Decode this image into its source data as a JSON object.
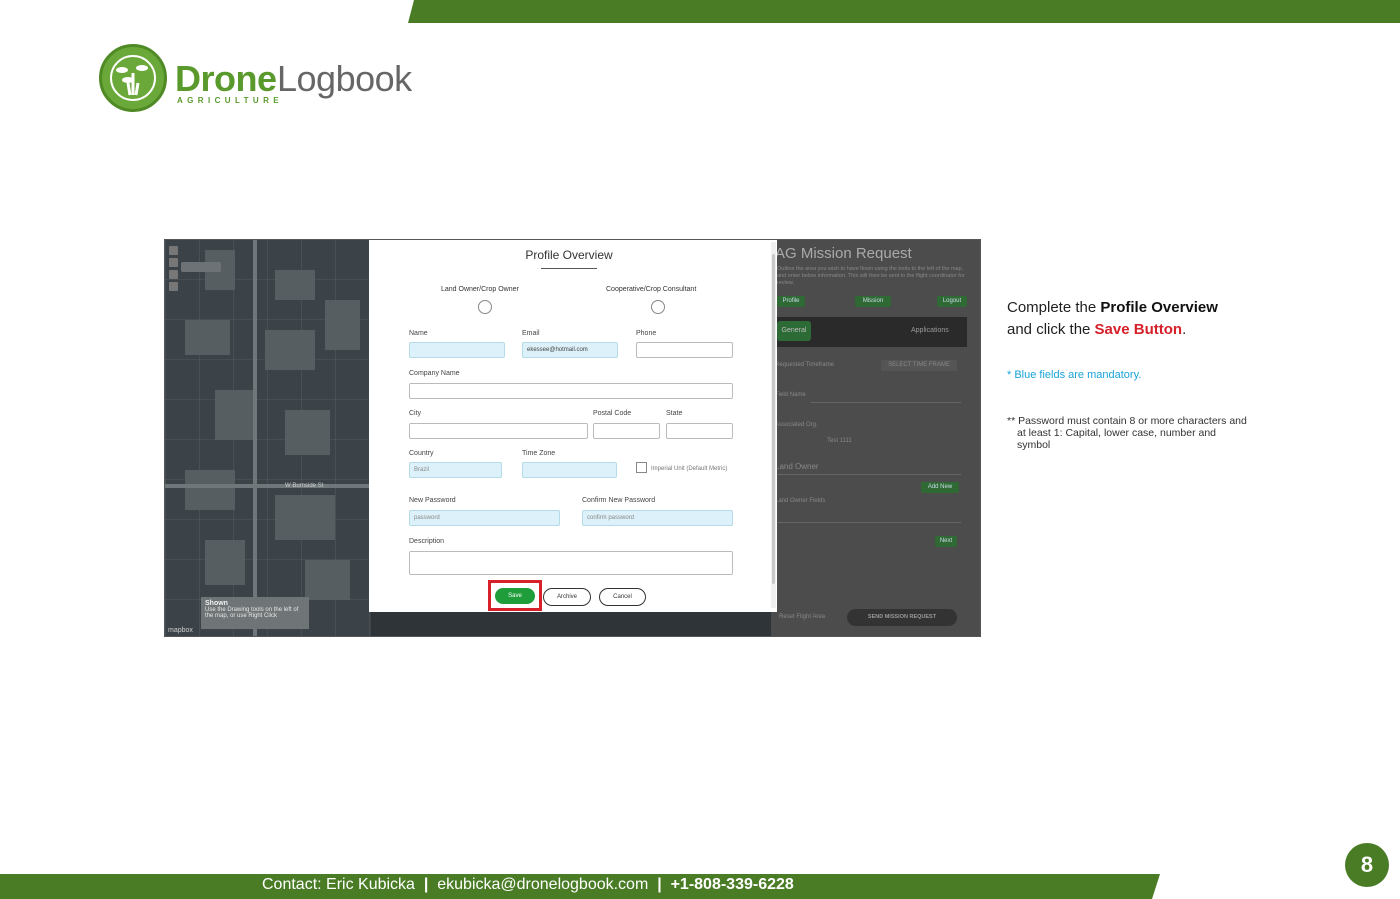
{
  "brand": {
    "name_part1": "Drone",
    "name_part2": "Logbook",
    "tagline": "AGRICULTURE"
  },
  "map": {
    "street_label": "W Burnside St",
    "tip_title": "Shown",
    "tip_text": "Use the Drawing tools on the left of the map, or use Right Click",
    "logo": "mapbox"
  },
  "background_panel": {
    "title": "AG Mission Request",
    "description": "Outline the area you wish to have flown using the tools to the left of the map, and enter below information. This will then be sent to the flight coordinator for review.",
    "buttons": [
      "Profile",
      "Mission",
      "Logout"
    ],
    "tabs": [
      "General",
      "Applications"
    ],
    "fields": [
      "Requested Timeframe",
      "Field Name",
      "Associated Org.",
      "Land Owner",
      "Land Owner Fields"
    ],
    "timeframe_button": "SELECT TIME FRAME",
    "org_value": "Test 1111",
    "add_new": "Add New",
    "next": "Next",
    "reset": "Reset Flight Area",
    "send": "SEND MISSION REQUEST"
  },
  "modal": {
    "title": "Profile Overview",
    "roles": [
      "Land Owner/Crop Owner",
      "Cooperative/Crop Consultant"
    ],
    "fields": {
      "name_label": "Name",
      "name_value": "",
      "email_label": "Email",
      "email_value": "ekessee@hotmail.com",
      "phone_label": "Phone",
      "phone_value": "",
      "company_label": "Company Name",
      "city_label": "City",
      "postal_label": "Postal Code",
      "state_label": "State",
      "country_label": "Country",
      "country_value": "Brazil",
      "timezone_label": "Time Zone",
      "imperial_label": "Imperial Unit (Default Metric)",
      "new_password_label": "New Password",
      "new_password_placeholder": "password",
      "confirm_password_label": "Confirm New Password",
      "confirm_password_placeholder": "confirm password",
      "description_label": "Description"
    },
    "buttons": {
      "save": "Save",
      "archive": "Archive",
      "cancel": "Cancel"
    }
  },
  "instructions": {
    "line1_prefix": "Complete the ",
    "line1_bold": "Profile Overview",
    "line2_prefix": "and click the ",
    "line2_red": "Save Button",
    "line2_suffix": ".",
    "blue_note": "*  Blue fields are mandatory.",
    "password_note_line1": "** Password must contain 8 or more characters and",
    "password_note_line2": "at least 1: Capital, lower case, number and symbol"
  },
  "footer": {
    "contact": "Contact: Eric Kubicka",
    "separator": "|",
    "email": "ekubicka@dronelogbook.com",
    "phone": "+1-808-339-6228"
  },
  "page_number": "8",
  "colors": {
    "brand_green": "#4a7c26",
    "save_green": "#1f9d3b",
    "highlight_red": "#d6202a",
    "note_blue": "#1aa3d8",
    "mandatory_field": "#dcf1f9"
  }
}
